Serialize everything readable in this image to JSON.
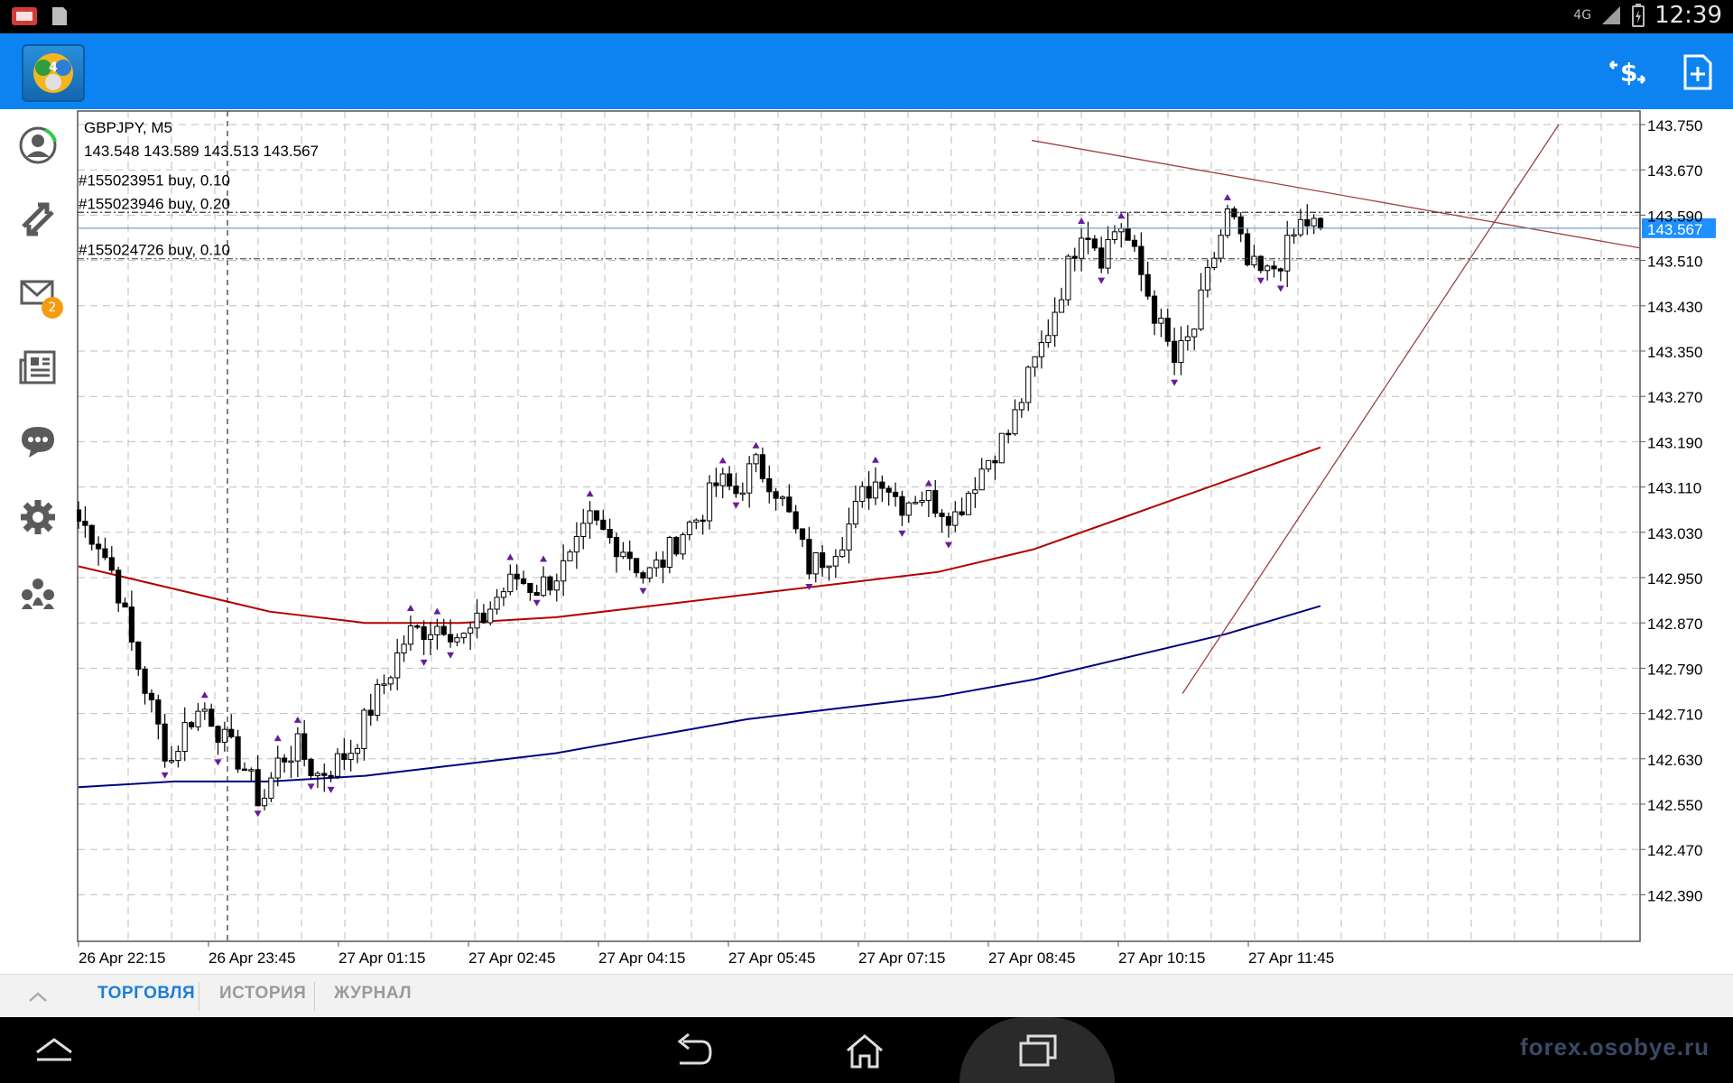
{
  "status_bar": {
    "time": "12:39",
    "network": "4G",
    "network2": "4G"
  },
  "header": {
    "logo_badge": "4",
    "actions": [
      "trade-dollar-icon",
      "new-order-icon"
    ]
  },
  "sidebar": {
    "items": [
      {
        "icon": "account-icon"
      },
      {
        "icon": "trade-icon"
      },
      {
        "icon": "mail-icon",
        "badge": "2"
      },
      {
        "icon": "news-icon"
      },
      {
        "icon": "chat-icon"
      },
      {
        "icon": "settings-icon"
      },
      {
        "icon": "community-icon"
      }
    ]
  },
  "chart": {
    "symbol_line": "GBPJPY, M5",
    "ohlc_line": "143.548 143.589 143.513 143.567",
    "current_price": "143.567",
    "current_price_value": 143.567,
    "orders": [
      {
        "label": "#155023951 buy, 0.10",
        "price": 143.595
      },
      {
        "label": "#155023946 buy, 0.20",
        "price": 143.595
      },
      {
        "label": "#155024726 buy, 0.10",
        "price": 143.513
      }
    ],
    "price_ticks": [
      "143.750",
      "143.670",
      "143.590",
      "143.510",
      "143.430",
      "143.350",
      "143.270",
      "143.190",
      "143.110",
      "143.030",
      "142.950",
      "142.870",
      "142.790",
      "142.710",
      "142.630",
      "142.550",
      "142.470",
      "142.390"
    ],
    "time_ticks": [
      "26 Apr 22:15",
      "26 Apr 23:45",
      "27 Apr 01:15",
      "27 Apr 02:45",
      "27 Apr 04:15",
      "27 Apr 05:45",
      "27 Apr 07:15",
      "27 Apr 08:45",
      "27 Apr 10:15",
      "27 Apr 11:45"
    ],
    "colors": {
      "grid": "#bdbdbd",
      "candle": "#000000",
      "ma_red": "#b30000",
      "ma_blue": "#000080",
      "fractal": "#6a1b9a",
      "trendline": "#a04040",
      "price_line": "#4f86c6",
      "price_tag": "#1e90ff"
    }
  },
  "chart_data": {
    "type": "candlestick",
    "title": "GBPJPY, M5",
    "ylim": [
      142.33,
      143.79
    ],
    "x_ticks": [
      "26 Apr 22:15",
      "26 Apr 23:45",
      "27 Apr 01:15",
      "27 Apr 02:45",
      "27 Apr 04:15",
      "27 Apr 05:45",
      "27 Apr 07:15",
      "27 Apr 08:45",
      "27 Apr 10:15",
      "27 Apr 11:45"
    ],
    "close_approx": [
      143.05,
      143.02,
      142.95,
      142.82,
      142.72,
      142.62,
      142.7,
      142.72,
      142.66,
      142.62,
      142.55,
      142.63,
      142.65,
      142.6,
      142.62,
      142.65,
      142.72,
      142.78,
      142.85,
      142.86,
      142.87,
      142.84,
      142.87,
      142.92,
      142.95,
      142.93,
      142.95,
      142.98,
      143.05,
      143.02,
      143.0,
      142.95,
      142.98,
      143.03,
      143.06,
      143.12,
      143.1,
      143.15,
      143.12,
      143.05,
      142.97,
      142.99,
      143.03,
      143.1,
      143.13,
      143.08,
      143.1,
      143.08,
      143.06,
      143.12,
      143.17,
      143.21,
      143.3,
      143.38,
      143.48,
      143.58,
      143.52,
      143.58,
      143.5,
      143.41,
      143.33,
      143.38,
      143.5,
      143.6,
      143.5,
      143.48,
      143.52,
      143.58,
      143.567
    ],
    "ma_red_approx": [
      142.97,
      142.93,
      142.89,
      142.87,
      142.87,
      142.88,
      142.9,
      142.92,
      142.94,
      142.96,
      143.0,
      143.06,
      143.12,
      143.18
    ],
    "ma_blue_approx": [
      142.58,
      142.59,
      142.59,
      142.6,
      142.62,
      142.64,
      142.67,
      142.7,
      142.72,
      142.74,
      142.77,
      142.81,
      142.85,
      142.9
    ],
    "grid": true
  },
  "bottom_tabs": {
    "tabs": [
      "ТОРГОВЛЯ",
      "ИСТОРИЯ",
      "ЖУРНАЛ"
    ],
    "active": 0
  },
  "nav_bar": {
    "watermark": "forex.osobye.ru"
  }
}
